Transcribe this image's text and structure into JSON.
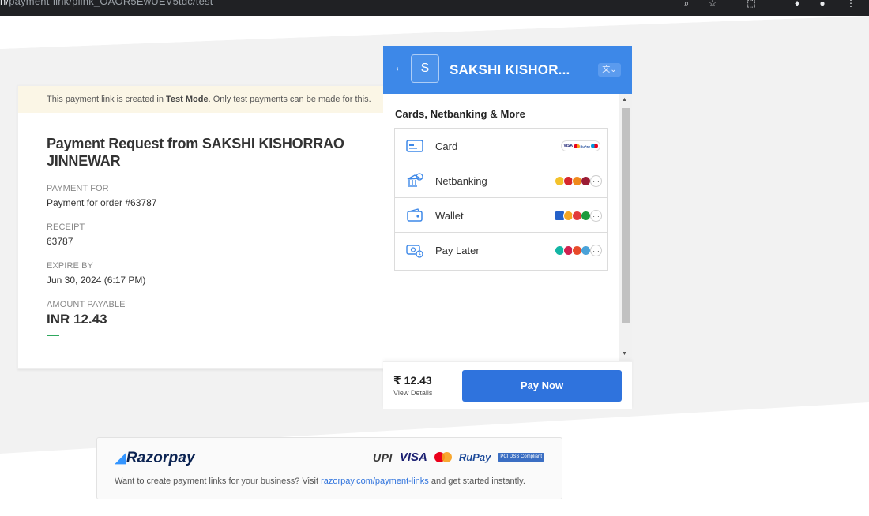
{
  "browser": {
    "url_prefix": "n/",
    "url_path": "payment-link/plink_OAOR5EwUEV5tdc/test"
  },
  "test_banner": {
    "prefix": "This payment link is created in ",
    "mode": "Test Mode",
    "suffix": ". Only test payments can be made for this."
  },
  "request": {
    "title": "Payment Request from SAKSHI KISHORRAO JINNEWAR",
    "fields": [
      {
        "label": "PAYMENT FOR",
        "value": "Payment for order #63787"
      },
      {
        "label": "RECEIPT",
        "value": "63787"
      },
      {
        "label": "EXPIRE BY",
        "value": "Jun 30, 2024 (6:17 PM)"
      }
    ],
    "amount_label": "AMOUNT PAYABLE",
    "amount": "INR 12.43"
  },
  "checkout": {
    "back_icon": "arrow-left-icon",
    "logo_letter": "S",
    "merchant_name": "SAKSHI KISHOR...",
    "language_icon": "translate-icon",
    "section_title": "Cards, Netbanking & More",
    "methods": [
      {
        "label": "Card",
        "icon": "card-icon"
      },
      {
        "label": "Netbanking",
        "icon": "bank-icon"
      },
      {
        "label": "Wallet",
        "icon": "wallet-icon"
      },
      {
        "label": "Pay Later",
        "icon": "paylater-icon"
      }
    ],
    "footer_amount": "₹ 12.43",
    "view_details": "View Details",
    "pay_button": "Pay Now",
    "colors": {
      "header": "#3d88e8",
      "button": "#2f73dd"
    }
  },
  "razorpay": {
    "logo": "Razorpay",
    "tagline_prefix": "Want to create payment links for your business? Visit ",
    "link": "razorpay.com/payment-links",
    "tagline_suffix": " and get started instantly.",
    "brands": {
      "upi": "UPI",
      "visa": "VISA",
      "rupay": "RuPay",
      "pci": "PCI DSS Compliant"
    }
  }
}
